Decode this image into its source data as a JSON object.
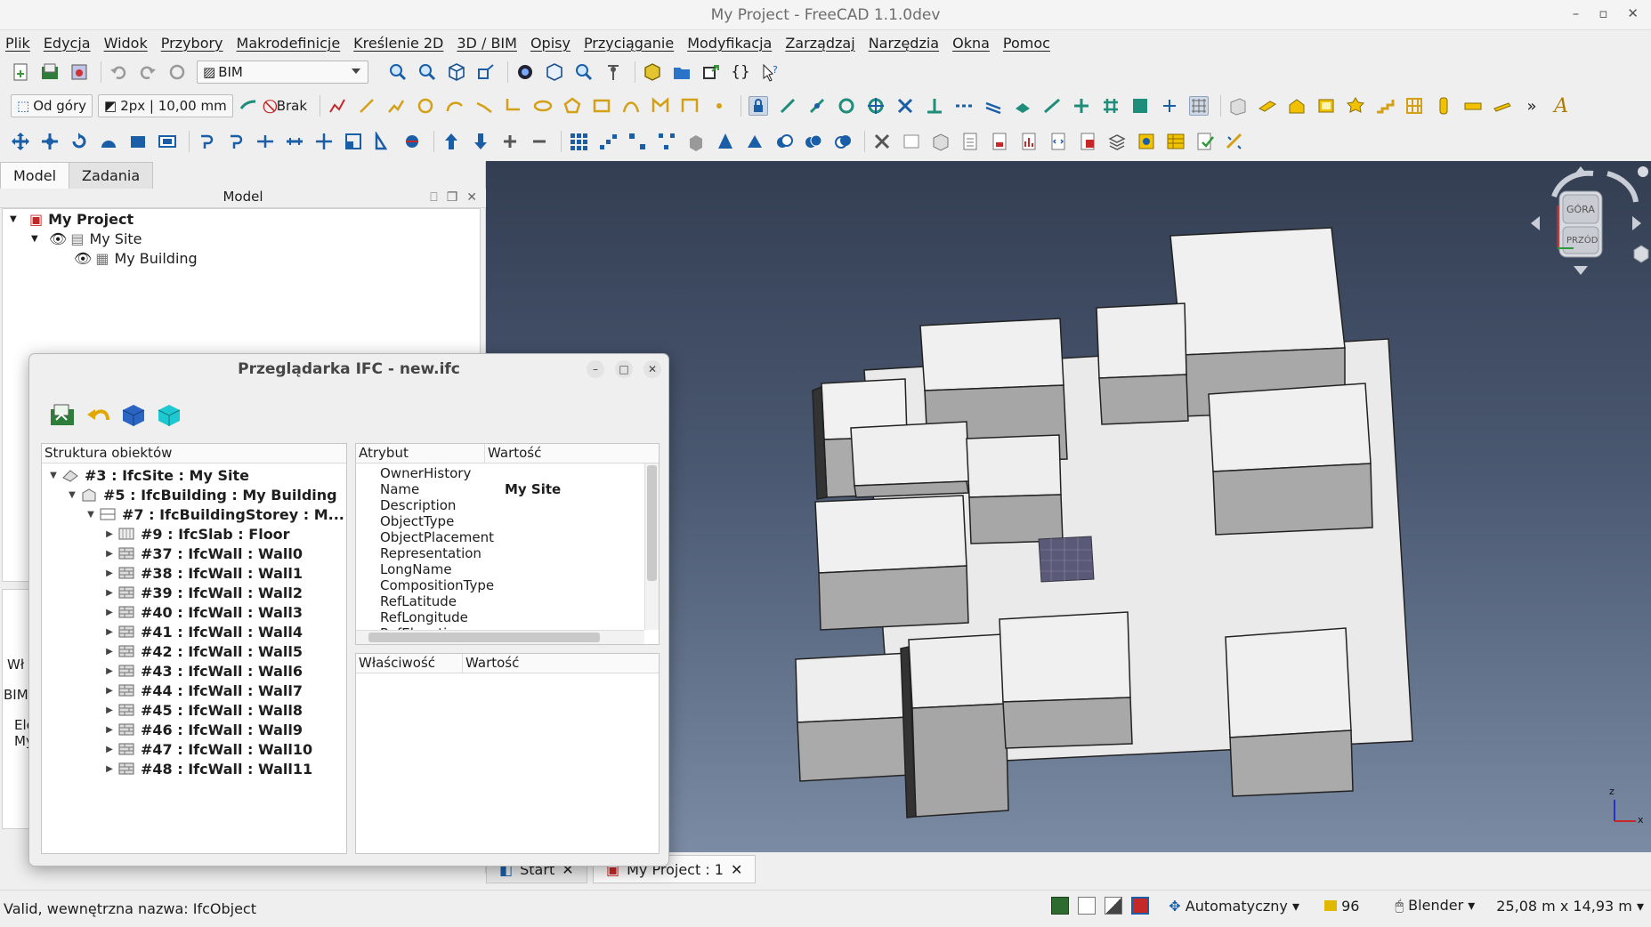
{
  "window": {
    "title": "My Project - FreeCAD 1.1.0dev",
    "controls": [
      "–",
      "▫",
      "✕"
    ]
  },
  "menu": [
    "Plik",
    "Edycja",
    "Widok",
    "Przybory",
    "Makrodefinicje",
    "Kreślenie 2D",
    "3D / BIM",
    "Opisy",
    "Przyciąganie",
    "Modyfikacja",
    "Zarządzaj",
    "Narzędzia",
    "Okna",
    "Pomoc"
  ],
  "toolbar1": {
    "workbench": "BIM"
  },
  "toolbar2": {
    "view_label": "Od góry",
    "line_style": "2px | 10,00 mm",
    "autogroup": "Brak",
    "overflow": "»"
  },
  "left_panel": {
    "tabs": [
      "Model",
      "Zadania"
    ],
    "header": "Model",
    "tree": [
      {
        "label": "My Project",
        "level": 0,
        "bold": true
      },
      {
        "label": "My Site",
        "level": 1,
        "bold": false
      },
      {
        "label": "My Building",
        "level": 2,
        "bold": false
      }
    ],
    "hidden_fragments": [
      "Wł",
      "BIM",
      "Ele",
      "My"
    ]
  },
  "ifc_dialog": {
    "title": "Przeglądarka IFC - new.ifc",
    "tree_header": "Struktura obiektów",
    "tree": [
      {
        "label": "#3 : IfcSite : My Site",
        "level": 0,
        "expanded": true,
        "icon": "site-icon"
      },
      {
        "label": "#5 : IfcBuilding : My Building",
        "level": 1,
        "expanded": true,
        "icon": "building-icon"
      },
      {
        "label": "#7 : IfcBuildingStorey : M...",
        "level": 2,
        "expanded": true,
        "icon": "storey-icon"
      },
      {
        "label": "#9 : IfcSlab : Floor",
        "level": 3,
        "expanded": false,
        "icon": "slab-icon"
      },
      {
        "label": "#37 : IfcWall : Wall0",
        "level": 3,
        "expanded": false,
        "icon": "wall-icon"
      },
      {
        "label": "#38 : IfcWall : Wall1",
        "level": 3,
        "expanded": false,
        "icon": "wall-icon"
      },
      {
        "label": "#39 : IfcWall : Wall2",
        "level": 3,
        "expanded": false,
        "icon": "wall-icon"
      },
      {
        "label": "#40 : IfcWall : Wall3",
        "level": 3,
        "expanded": false,
        "icon": "wall-icon"
      },
      {
        "label": "#41 : IfcWall : Wall4",
        "level": 3,
        "expanded": false,
        "icon": "wall-icon"
      },
      {
        "label": "#42 : IfcWall : Wall5",
        "level": 3,
        "expanded": false,
        "icon": "wall-icon"
      },
      {
        "label": "#43 : IfcWall : Wall6",
        "level": 3,
        "expanded": false,
        "icon": "wall-icon"
      },
      {
        "label": "#44 : IfcWall : Wall7",
        "level": 3,
        "expanded": false,
        "icon": "wall-icon"
      },
      {
        "label": "#45 : IfcWall : Wall8",
        "level": 3,
        "expanded": false,
        "icon": "wall-icon"
      },
      {
        "label": "#46 : IfcWall : Wall9",
        "level": 3,
        "expanded": false,
        "icon": "wall-icon"
      },
      {
        "label": "#47 : IfcWall : Wall10",
        "level": 3,
        "expanded": false,
        "icon": "wall-icon"
      },
      {
        "label": "#48 : IfcWall : Wall11",
        "level": 3,
        "expanded": false,
        "icon": "wall-icon"
      }
    ],
    "attr_headers": [
      "Atrybut",
      "Wartość"
    ],
    "attributes": [
      {
        "k": "OwnerHistory",
        "v": ""
      },
      {
        "k": "Name",
        "v": "My Site"
      },
      {
        "k": "Description",
        "v": ""
      },
      {
        "k": "ObjectType",
        "v": ""
      },
      {
        "k": "ObjectPlacement",
        "v": ""
      },
      {
        "k": "Representation",
        "v": ""
      },
      {
        "k": "LongName",
        "v": ""
      },
      {
        "k": "CompositionType",
        "v": ""
      },
      {
        "k": "RefLatitude",
        "v": ""
      },
      {
        "k": "RefLongitude",
        "v": ""
      },
      {
        "k": "RefElevation",
        "v": ""
      }
    ],
    "prop_headers": [
      "Właściwość",
      "Wartość"
    ]
  },
  "navcube": {
    "top": "GÓRA",
    "front": "PRZÓD"
  },
  "axis": {
    "x": "x",
    "z": "z"
  },
  "doc_tabs": [
    "Start",
    "My Project : 1"
  ],
  "status": {
    "message": "Valid, wewnętrzna nazwa: IfcObject",
    "selection_mode": "Automatyczny",
    "count": "96",
    "nav_style": "Blender",
    "dimensions": "25,08 m x 14,93 m"
  }
}
